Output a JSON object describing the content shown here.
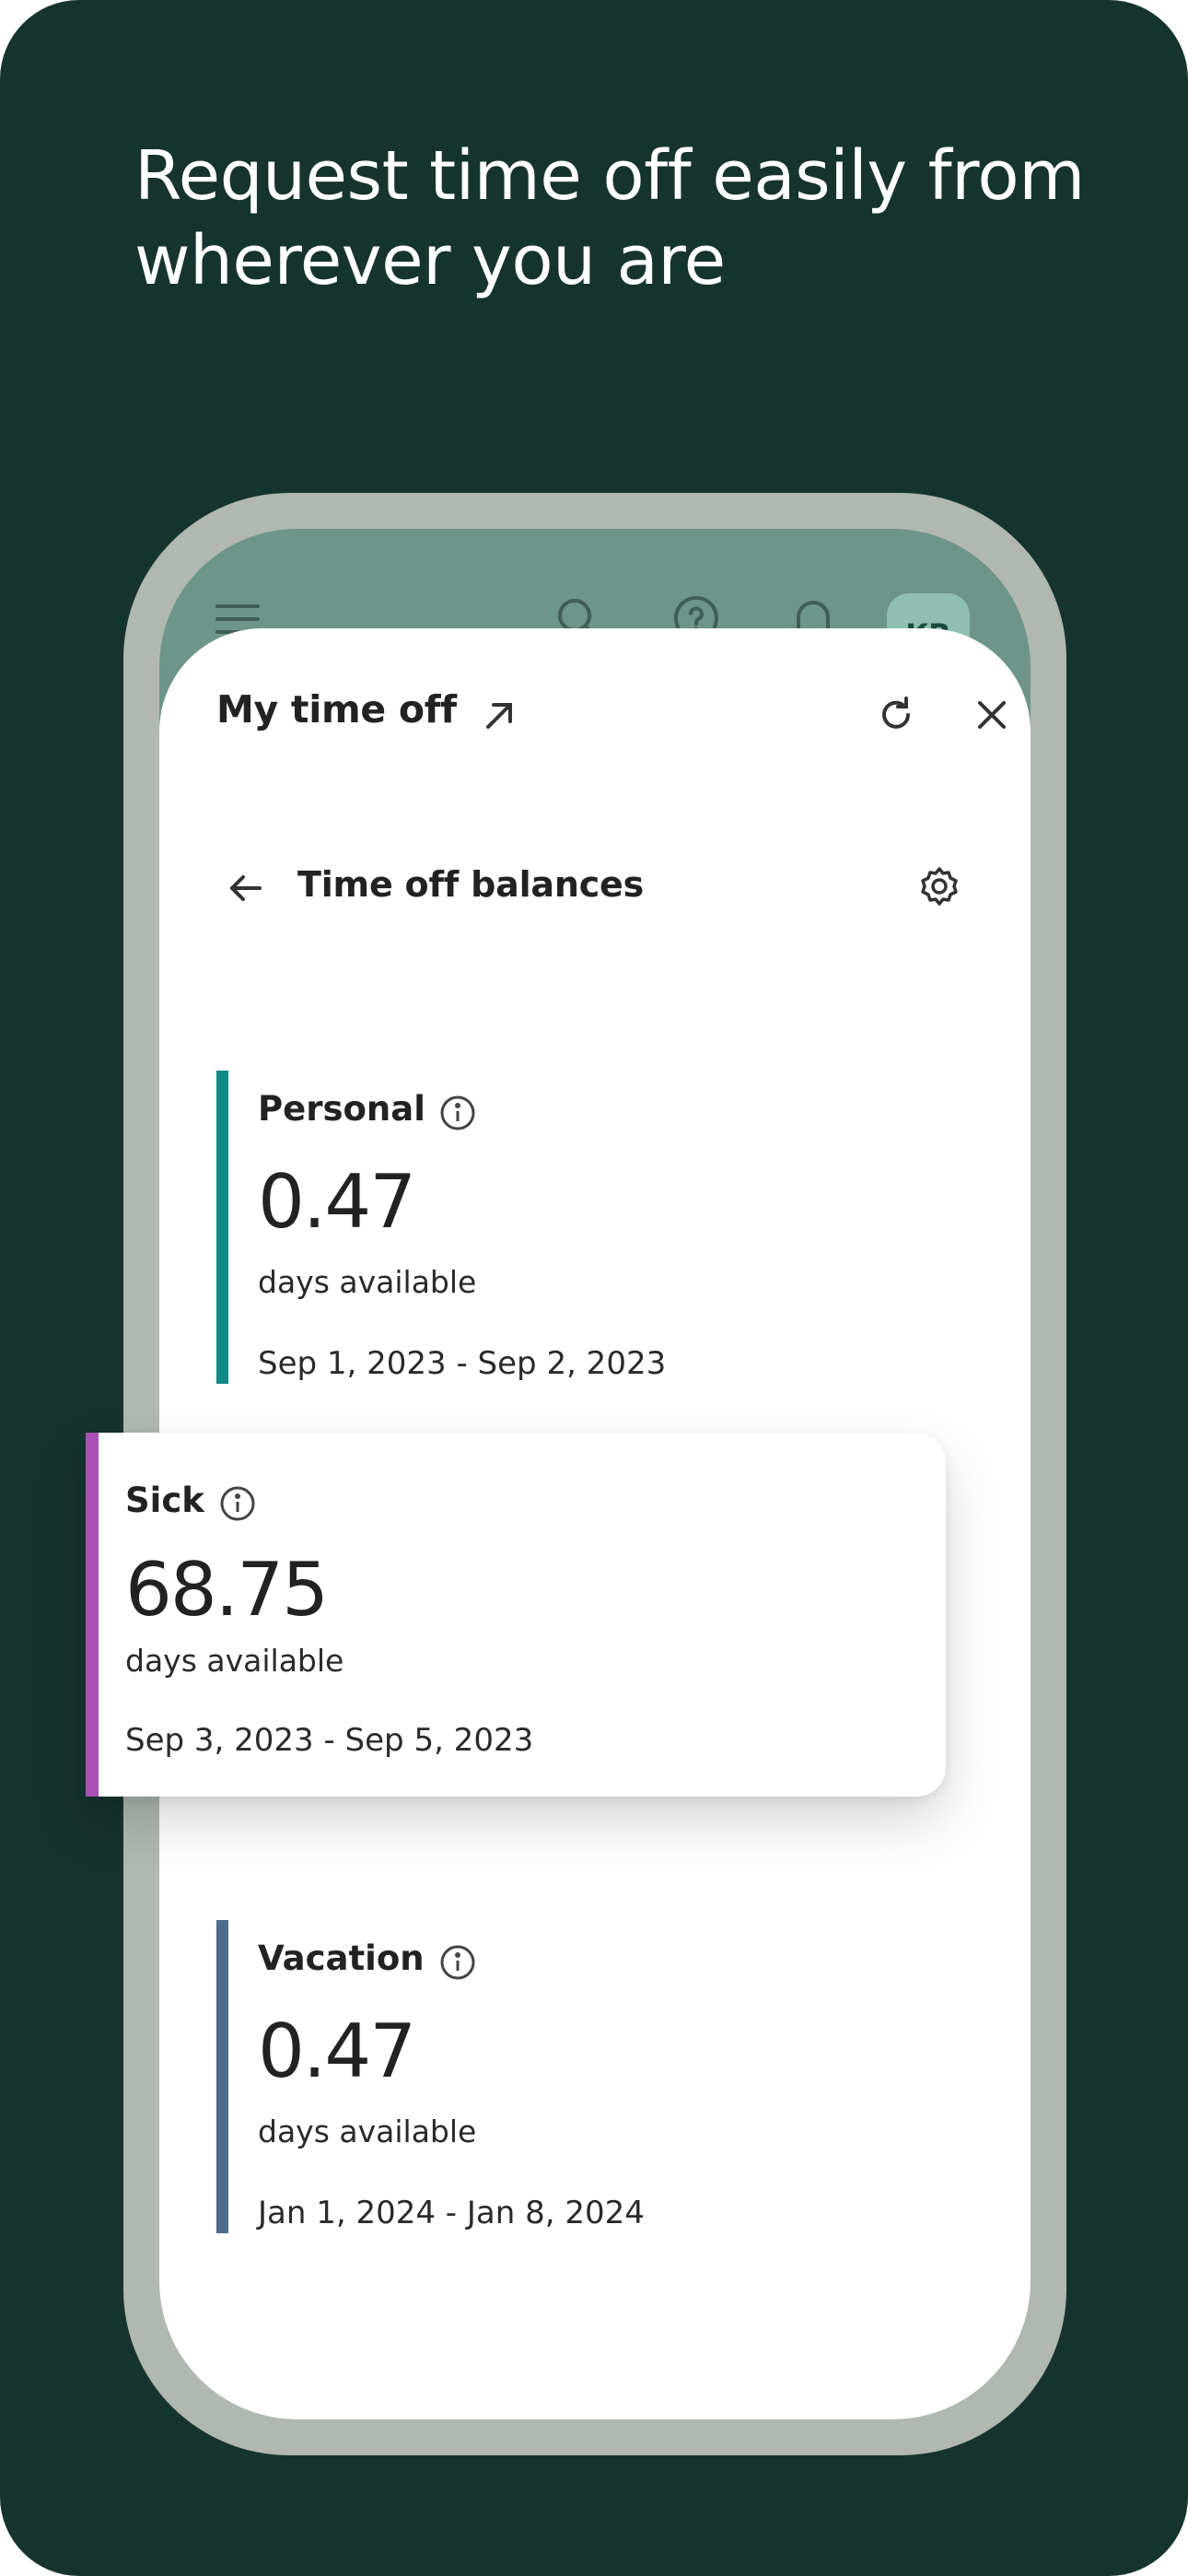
{
  "headline": "Request time off easily from wherever you are",
  "app_bar": {
    "avatar_initials": "KR",
    "icons": [
      "menu-icon",
      "search-icon",
      "help-icon",
      "bell-icon"
    ]
  },
  "sheet": {
    "title": "My time off",
    "subtitle": "Time off balances"
  },
  "balances": [
    {
      "name": "Personal",
      "value": "0.47",
      "label": "days available",
      "range": "Sep 1, 2023 - Sep 2, 2023",
      "color": "#0f8a86"
    },
    {
      "name": "Sick",
      "value": "68.75",
      "label": "days available",
      "range": "Sep 3, 2023 - Sep 5, 2023",
      "color": "#a94fb5"
    },
    {
      "name": "Vacation",
      "value": "0.47",
      "label": "days available",
      "range": "Jan 1, 2024 - Jan 8, 2024",
      "color": "#4d6d8c"
    }
  ],
  "colors": {
    "background": "#15342d",
    "phone_frame": "#b1b8b1",
    "app_bar": "#6e958a",
    "avatar": "#8fbfb1"
  }
}
